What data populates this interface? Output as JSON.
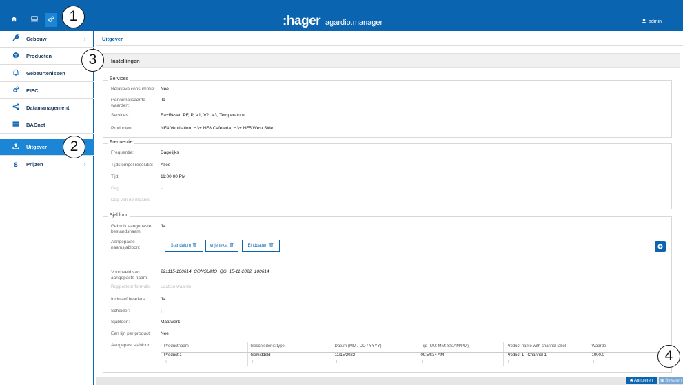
{
  "topbar": {
    "logo": ":hager",
    "app_name": "agardio.manager",
    "user": "admin"
  },
  "sidebar": {
    "items": [
      {
        "label": "Gebouw",
        "icon": "wrench-icon",
        "chevron": "›"
      },
      {
        "label": "Producten",
        "icon": "cube-icon"
      },
      {
        "label": "Gebeurtenissen",
        "icon": "bell-icon"
      },
      {
        "label": "EIEC",
        "icon": "cogs-icon"
      },
      {
        "label": "Datamanagement",
        "icon": "share-icon"
      },
      {
        "label": "BACnet",
        "icon": "list-icon"
      },
      {
        "label": "Uitgever",
        "icon": "upload-icon",
        "active": true
      },
      {
        "label": "Prijzen",
        "icon": "dollar-icon",
        "chevron": "›"
      }
    ]
  },
  "breadcrumb": "Uitgever",
  "tab": "Instellingen",
  "services": {
    "title": "Services",
    "rows": [
      {
        "label": "Relatieve consumptie:",
        "value": "Nee"
      },
      {
        "label": "Genormaliseerde waarden:",
        "value": "Ja"
      },
      {
        "label": "Services:",
        "value": "Ea+Reset, PF, P, V1, V2, V3, Temperature"
      },
      {
        "label": "Producten:",
        "value": "NF4 Ventilation, H3+ NF8 Cafeteria, H3+ NF5 West Side"
      }
    ]
  },
  "frequentie": {
    "title": "Frequentie",
    "rows": [
      {
        "label": "Frequentie:",
        "value": "Dagelijks"
      },
      {
        "label": "Tijdstempel resolutie:",
        "value": "Alles"
      },
      {
        "label": "Tijd:",
        "value": "11:00:00 PM"
      },
      {
        "label": "Dag:",
        "value": "--"
      },
      {
        "label": "Dag van de maand:",
        "value": "--"
      }
    ]
  },
  "sjabloon": {
    "title": "Sjabloon",
    "custom_filename_label": "Gebruik aangepaste bestandsnaam:",
    "custom_filename_value": "Ja",
    "name_template_label": "Aangepaste naamsjabloon:",
    "chips": [
      "Startdatum",
      "Vrije tekst",
      "Einddatum"
    ],
    "example_label": "Voorbeeld van aangepaste naam:",
    "example_value": "221115-100614_CONSUMO_QG_15-11-2022_100614",
    "formula_label": "Rapporteer formule:",
    "formula_value": "Laatste waarde",
    "headers_label": "Inclusief headers:",
    "headers_value": "Ja",
    "separator_label": "Scheider:",
    "separator_value": ";",
    "template_label": "Sjabloon:",
    "template_value": "Maatwerk",
    "one_line_label": "Een lijn per product:",
    "one_line_value": "Nee",
    "custom_template_label": "Aangepast sjabloon:",
    "table": {
      "headers": [
        "Productnaam",
        "Geschiedenis type",
        "Datum (MM / DD / YYYY)",
        "Tijd (UU: MM: SS AM/PM)",
        "Product name with channel label",
        "Waarde"
      ],
      "row": [
        "Product 1",
        "Gemiddeld",
        "11/15/2022",
        "09:54:34 AM",
        "Product 1 - Channel 1",
        "1000.0"
      ],
      "dots": [
        "⋮",
        "⋮",
        "⋮",
        "⋮",
        "⋮",
        "⋮"
      ]
    }
  },
  "footer": {
    "cancel": "Annuleren",
    "save": "Bewaren"
  },
  "callouts": [
    "1",
    "2",
    "3",
    "4"
  ]
}
